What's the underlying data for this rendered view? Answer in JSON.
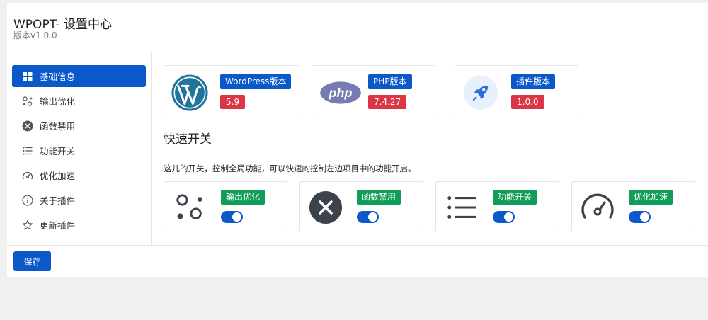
{
  "header": {
    "title": "WPOPT- 设置中心",
    "version": "版本v1.0.0"
  },
  "sidebar": {
    "items": [
      {
        "label": "基础信息",
        "icon": "grid-icon",
        "active": true
      },
      {
        "label": "输出优化",
        "icon": "bubbles-icon",
        "active": false
      },
      {
        "label": "函数禁用",
        "icon": "x-circle-icon",
        "active": false
      },
      {
        "label": "功能开关",
        "icon": "list-icon",
        "active": false
      },
      {
        "label": "优化加速",
        "icon": "speedometer-icon",
        "active": false
      },
      {
        "label": "关于插件",
        "icon": "info-icon",
        "active": false
      },
      {
        "label": "更新插件",
        "icon": "star-icon",
        "active": false
      }
    ]
  },
  "versions": [
    {
      "label": "WordPress版本",
      "value": "5.9",
      "icon": "wordpress-icon"
    },
    {
      "label": "PHP版本",
      "value": "7.4.27",
      "icon": "php-icon"
    },
    {
      "label": "插件版本",
      "value": "1.0.0",
      "icon": "rocket-icon"
    }
  ],
  "quick_switch": {
    "title": "快速开关",
    "description": "这儿的开关，控制全局功能，可以快速的控制左边项目中的功能开启。",
    "cards": [
      {
        "label": "输出优化",
        "icon": "bubbles-icon",
        "enabled": true
      },
      {
        "label": "函数禁用",
        "icon": "x-circle-icon",
        "enabled": true
      },
      {
        "label": "功能开关",
        "icon": "list-icon",
        "enabled": true
      },
      {
        "label": "优化加速",
        "icon": "speedometer-icon",
        "enabled": true
      }
    ]
  },
  "footer": {
    "save_label": "保存"
  },
  "colors": {
    "primary": "#0a58ca",
    "danger": "#dc3545",
    "success": "#0f9d58"
  }
}
